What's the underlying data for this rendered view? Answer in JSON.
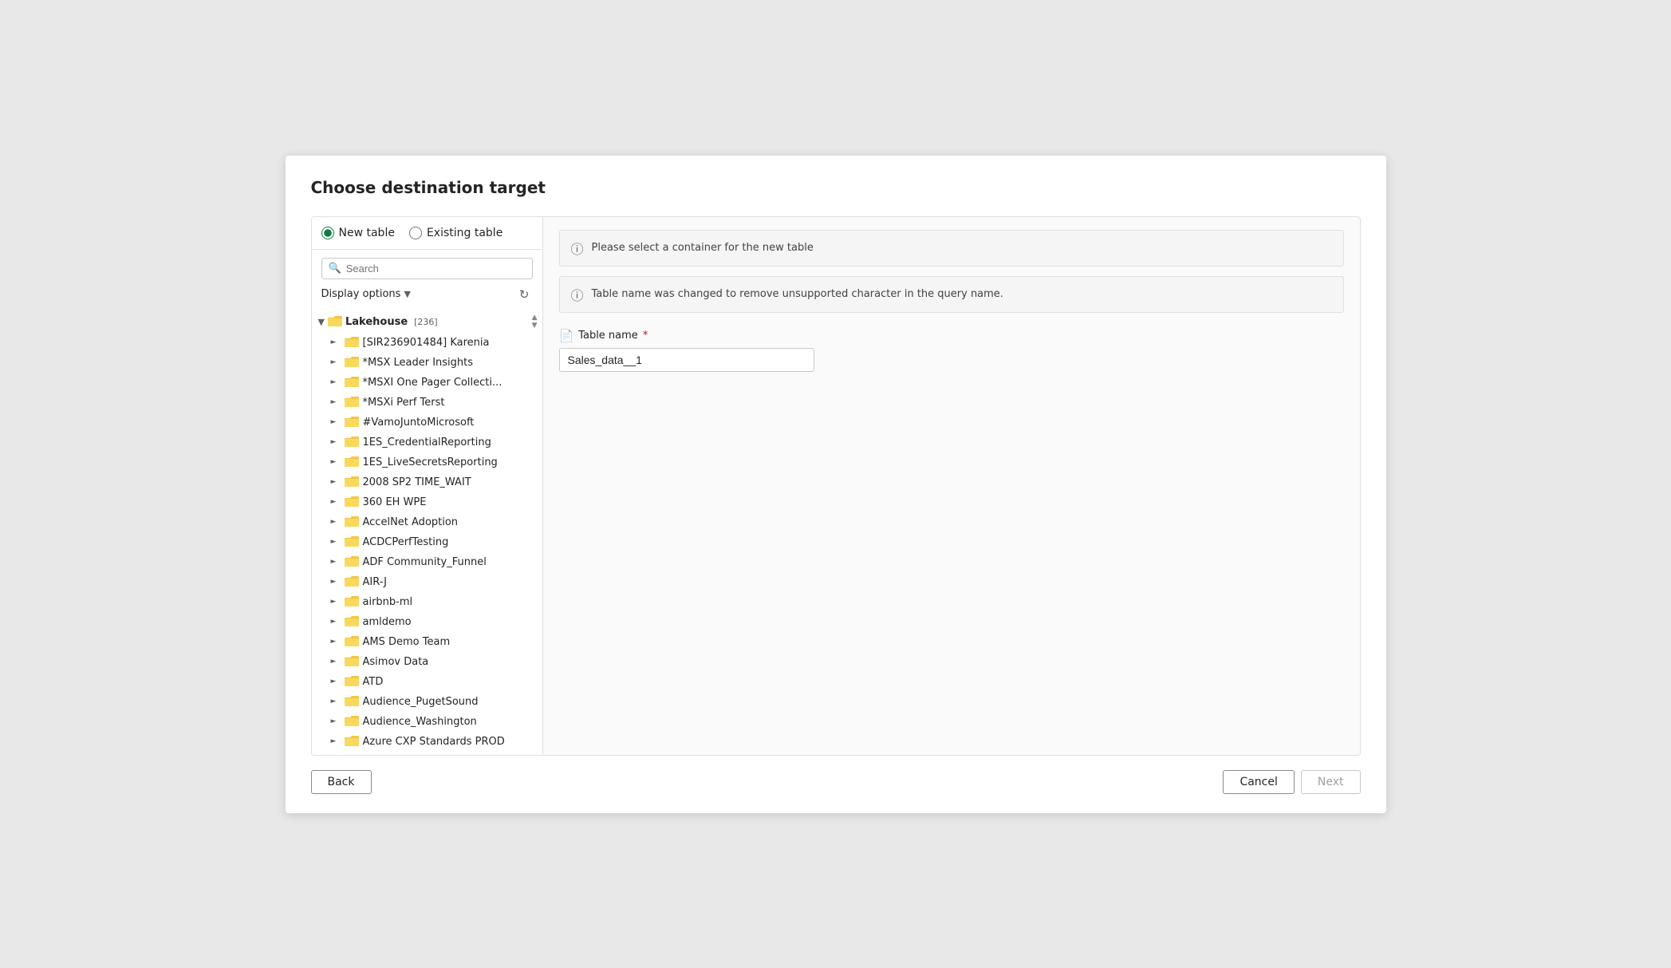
{
  "dialog": {
    "title": "Choose destination target"
  },
  "radio": {
    "new_table_label": "New table",
    "existing_table_label": "Existing table",
    "selected": "new_table"
  },
  "search": {
    "placeholder": "Search"
  },
  "display_options": {
    "label": "Display options"
  },
  "tree": {
    "root_label": "Lakehouse",
    "root_badge": "[236]",
    "items": [
      {
        "label": "[SIR236901484] Karenia"
      },
      {
        "label": "*MSX Leader Insights"
      },
      {
        "label": "*MSXI One Pager Collecti..."
      },
      {
        "label": "*MSXi Perf Terst"
      },
      {
        "label": "#VamoJuntoMicrosoft"
      },
      {
        "label": "1ES_CredentialReporting"
      },
      {
        "label": "1ES_LiveSecretsReporting"
      },
      {
        "label": "2008 SP2 TIME_WAIT"
      },
      {
        "label": "360 EH WPE"
      },
      {
        "label": "AccelNet Adoption"
      },
      {
        "label": "ACDCPerfTesting"
      },
      {
        "label": "ADF Community_Funnel"
      },
      {
        "label": "AIR-J"
      },
      {
        "label": "airbnb-ml"
      },
      {
        "label": "amldemo"
      },
      {
        "label": "AMS Demo Team"
      },
      {
        "label": "Asimov Data"
      },
      {
        "label": "ATD"
      },
      {
        "label": "Audience_PugetSound"
      },
      {
        "label": "Audience_Washington"
      },
      {
        "label": "Azure CXP Standards PROD"
      }
    ]
  },
  "right_panel": {
    "banner1": "Please select a container for the new table",
    "banner2": "Table name was changed to remove unsupported character in the query name.",
    "field_label": "Table name",
    "field_value": "Sales_data__1"
  },
  "footer": {
    "back_label": "Back",
    "cancel_label": "Cancel",
    "next_label": "Next"
  }
}
